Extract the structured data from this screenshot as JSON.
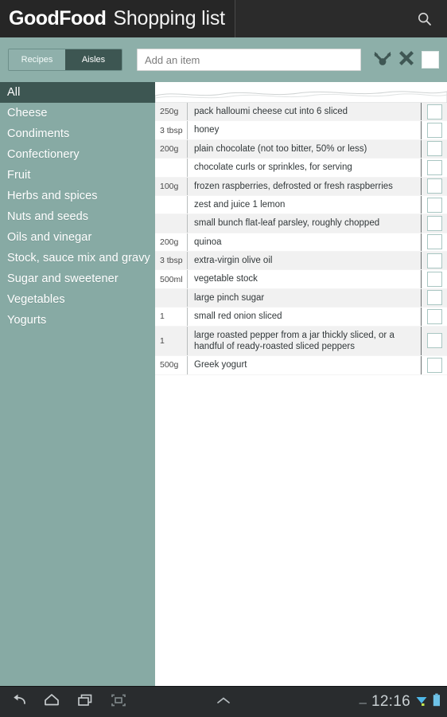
{
  "titlebar": {
    "brand": "GoodFood",
    "title": "Shopping list",
    "search_icon": "search-icon"
  },
  "actionbar": {
    "tabs": [
      {
        "label": "Recipes",
        "active": false
      },
      {
        "label": "Aisles",
        "active": true
      }
    ],
    "add_input_value": "",
    "add_input_placeholder": "Add an item",
    "icons": [
      {
        "name": "sort-merge-icon"
      },
      {
        "name": "clear-all-icon"
      },
      {
        "name": "select-all-checkbox"
      }
    ]
  },
  "sidebar": {
    "items": [
      {
        "label": "All",
        "selected": true
      },
      {
        "label": "Cheese",
        "selected": false
      },
      {
        "label": "Condiments",
        "selected": false
      },
      {
        "label": "Confectionery",
        "selected": false
      },
      {
        "label": "Fruit",
        "selected": false
      },
      {
        "label": "Herbs and spices",
        "selected": false
      },
      {
        "label": "Nuts and seeds",
        "selected": false
      },
      {
        "label": "Oils and vinegar",
        "selected": false
      },
      {
        "label": "Stock, sauce mix and gravy",
        "selected": false
      },
      {
        "label": "Sugar and sweetener",
        "selected": false
      },
      {
        "label": "Vegetables",
        "selected": false
      },
      {
        "label": "Yogurts",
        "selected": false
      }
    ]
  },
  "list": {
    "items": [
      {
        "qty": "250g",
        "name": "pack halloumi cheese cut into 6 sliced",
        "checked": false
      },
      {
        "qty": "3 tbsp",
        "name": "honey",
        "checked": false
      },
      {
        "qty": "200g",
        "name": "plain chocolate (not too bitter, 50% or less)",
        "checked": false
      },
      {
        "qty": "",
        "name": "chocolate curls or sprinkles, for serving",
        "checked": false
      },
      {
        "qty": "100g",
        "name": "frozen raspberries, defrosted or fresh raspberries",
        "checked": false
      },
      {
        "qty": "",
        "name": "zest and juice 1 lemon",
        "checked": false
      },
      {
        "qty": "",
        "name": "small bunch flat-leaf parsley, roughly chopped",
        "checked": false
      },
      {
        "qty": "200g",
        "name": "quinoa",
        "checked": false
      },
      {
        "qty": "3 tbsp",
        "name": "extra-virgin olive oil",
        "checked": false
      },
      {
        "qty": "500ml",
        "name": "vegetable stock",
        "checked": false
      },
      {
        "qty": "",
        "name": "large pinch sugar",
        "checked": false
      },
      {
        "qty": "1",
        "name": "small red onion sliced",
        "checked": false
      },
      {
        "qty": "1",
        "name": "large roasted pepper from a jar thickly sliced, or a handful of ready-roasted sliced peppers",
        "checked": false
      },
      {
        "qty": "500g",
        "name": "Greek yogurt",
        "checked": false
      }
    ]
  },
  "navbar": {
    "buttons": [
      {
        "name": "back-icon"
      },
      {
        "name": "home-icon"
      },
      {
        "name": "recent-apps-icon"
      },
      {
        "name": "screenshot-icon"
      }
    ],
    "expand_icon": "chevron-up-icon",
    "minus": "–",
    "clock": "12:16",
    "status_icons": [
      {
        "name": "wifi-icon"
      },
      {
        "name": "battery-icon"
      }
    ]
  },
  "colors": {
    "titlebar_bg": "#2b2b2b",
    "accent_teal": "#8dafa9",
    "sidebar_bg": "#87aaa4",
    "selected_dark": "#3d5652",
    "row_stripe": "#f1f1f1",
    "navbar_bg": "#292c2e",
    "checkbox_border": "#a9c6c2"
  }
}
